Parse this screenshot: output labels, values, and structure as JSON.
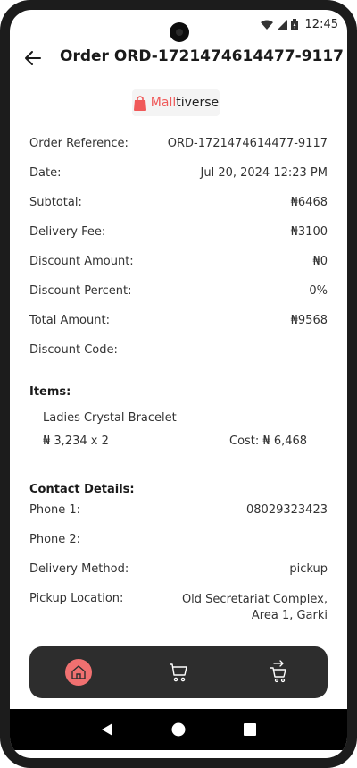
{
  "status_bar": {
    "time": "12:45",
    "icons": [
      "wifi-icon",
      "signal-icon",
      "battery-icon"
    ]
  },
  "header": {
    "title": "Order ORD-1721474614477-9117",
    "back_icon": "arrow-left-icon"
  },
  "logo": {
    "prefix": "Mall",
    "suffix": "tiverse",
    "accent_color": "#f05a5a"
  },
  "summary": [
    {
      "label": "Order Reference:",
      "value": "ORD-1721474614477-9117"
    },
    {
      "label": "Date:",
      "value": "Jul 20, 2024 12:23 PM"
    },
    {
      "label": "Subtotal:",
      "value": "₦6468"
    },
    {
      "label": "Delivery Fee:",
      "value": "₦3100"
    },
    {
      "label": "Discount Amount:",
      "value": "₦0"
    },
    {
      "label": "Discount Percent:",
      "value": "0%"
    },
    {
      "label": "Total Amount:",
      "value": "₦9568"
    },
    {
      "label": "Discount Code:",
      "value": ""
    }
  ],
  "items": {
    "title": "Items:",
    "list": [
      {
        "name": "Ladies Crystal Bracelet",
        "qty": "₦ 3,234 x 2",
        "cost": "Cost: ₦ 6,468"
      }
    ]
  },
  "contact": {
    "title": "Contact Details:",
    "phone1_label": "Phone 1:",
    "phone1": "08029323423",
    "phone2_label": "Phone 2:",
    "phone2": "",
    "delivery_label": "Delivery Method:",
    "delivery": "pickup",
    "pickup_label": "Pickup Location:",
    "pickup": "Old Secretariat Complex, Area 1, Garki"
  },
  "bottom_nav": {
    "items": [
      "home-icon",
      "cart-icon",
      "orders-icon"
    ],
    "active": "home-icon",
    "active_color": "#f07070"
  },
  "system_nav": [
    "back-icon",
    "home-circle-icon",
    "recents-icon"
  ]
}
